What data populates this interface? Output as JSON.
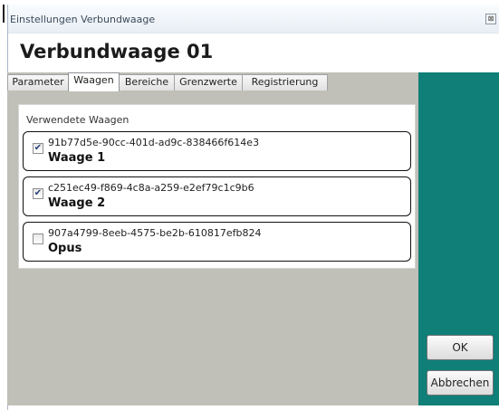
{
  "window": {
    "title": "Einstellungen Verbundwaage",
    "close_glyph": "⊠"
  },
  "heading": "Verbundwaage 01",
  "tabs": [
    {
      "label": "Parameter",
      "active": false
    },
    {
      "label": "Waagen",
      "active": true
    },
    {
      "label": "Bereiche",
      "active": false
    },
    {
      "label": "Grenzwerte",
      "active": false
    },
    {
      "label": "Registrierung",
      "active": false
    }
  ],
  "panel": {
    "label": "Verwendete Waagen",
    "items": [
      {
        "id": "91b77d5e-90cc-401d-ad9c-838466f614e3",
        "name": "Waage 1",
        "checked": true,
        "check_glyph": "✔"
      },
      {
        "id": "c251ec49-f869-4c8a-a259-e2ef79c1c9b6",
        "name": "Waage 2",
        "checked": true,
        "check_glyph": "✔"
      },
      {
        "id": "907a4799-8eeb-4575-be2b-610817efb824",
        "name": "Opus",
        "checked": false,
        "check_glyph": ""
      }
    ]
  },
  "buttons": {
    "ok": "OK",
    "cancel": "Abbrechen"
  },
  "colors": {
    "side_panel": "#0f7f77",
    "content_bg": "#c0c0b8"
  }
}
